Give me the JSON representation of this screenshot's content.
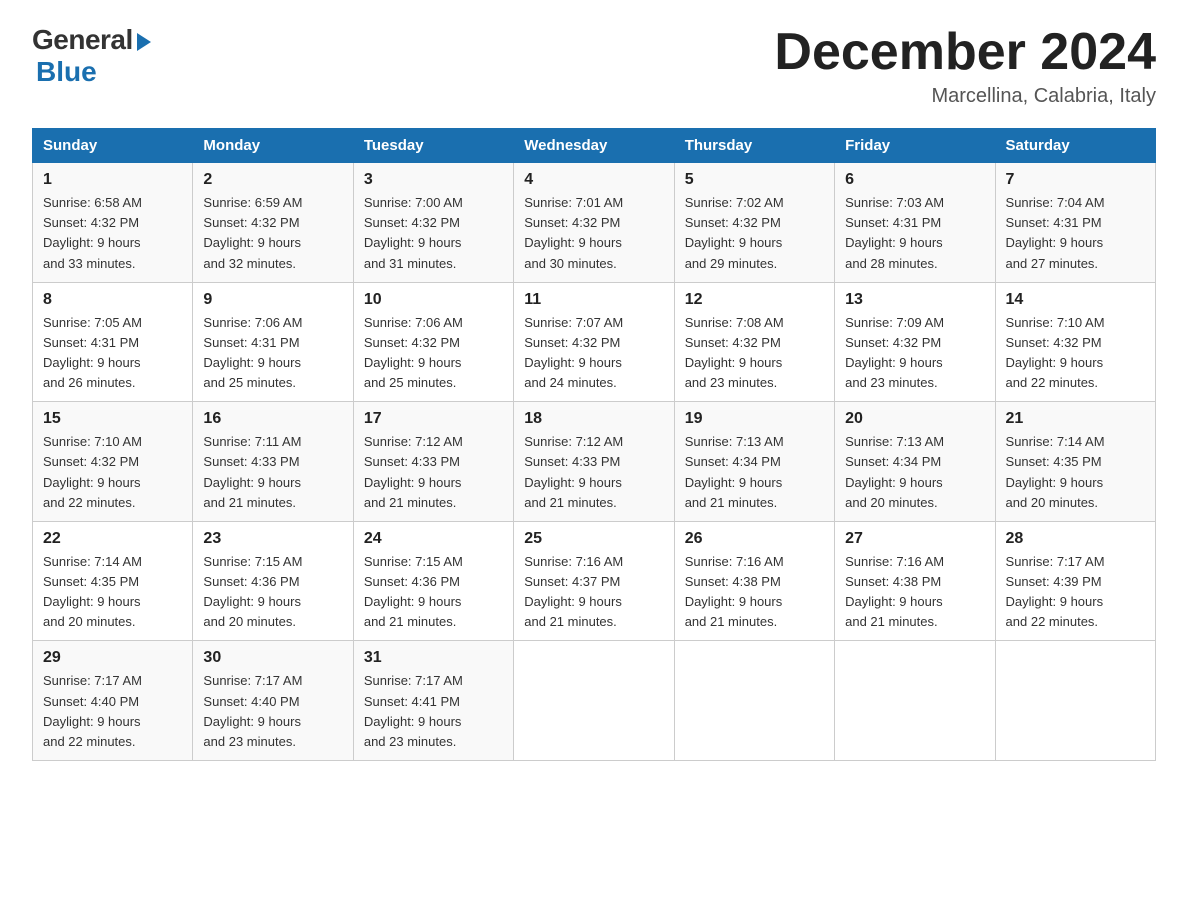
{
  "header": {
    "logo_general": "General",
    "logo_blue": "Blue",
    "title": "December 2024",
    "location": "Marcellina, Calabria, Italy"
  },
  "days_of_week": [
    "Sunday",
    "Monday",
    "Tuesday",
    "Wednesday",
    "Thursday",
    "Friday",
    "Saturday"
  ],
  "weeks": [
    [
      {
        "day": "1",
        "sunrise": "6:58 AM",
        "sunset": "4:32 PM",
        "daylight": "9 hours and 33 minutes."
      },
      {
        "day": "2",
        "sunrise": "6:59 AM",
        "sunset": "4:32 PM",
        "daylight": "9 hours and 32 minutes."
      },
      {
        "day": "3",
        "sunrise": "7:00 AM",
        "sunset": "4:32 PM",
        "daylight": "9 hours and 31 minutes."
      },
      {
        "day": "4",
        "sunrise": "7:01 AM",
        "sunset": "4:32 PM",
        "daylight": "9 hours and 30 minutes."
      },
      {
        "day": "5",
        "sunrise": "7:02 AM",
        "sunset": "4:32 PM",
        "daylight": "9 hours and 29 minutes."
      },
      {
        "day": "6",
        "sunrise": "7:03 AM",
        "sunset": "4:31 PM",
        "daylight": "9 hours and 28 minutes."
      },
      {
        "day": "7",
        "sunrise": "7:04 AM",
        "sunset": "4:31 PM",
        "daylight": "9 hours and 27 minutes."
      }
    ],
    [
      {
        "day": "8",
        "sunrise": "7:05 AM",
        "sunset": "4:31 PM",
        "daylight": "9 hours and 26 minutes."
      },
      {
        "day": "9",
        "sunrise": "7:06 AM",
        "sunset": "4:31 PM",
        "daylight": "9 hours and 25 minutes."
      },
      {
        "day": "10",
        "sunrise": "7:06 AM",
        "sunset": "4:32 PM",
        "daylight": "9 hours and 25 minutes."
      },
      {
        "day": "11",
        "sunrise": "7:07 AM",
        "sunset": "4:32 PM",
        "daylight": "9 hours and 24 minutes."
      },
      {
        "day": "12",
        "sunrise": "7:08 AM",
        "sunset": "4:32 PM",
        "daylight": "9 hours and 23 minutes."
      },
      {
        "day": "13",
        "sunrise": "7:09 AM",
        "sunset": "4:32 PM",
        "daylight": "9 hours and 23 minutes."
      },
      {
        "day": "14",
        "sunrise": "7:10 AM",
        "sunset": "4:32 PM",
        "daylight": "9 hours and 22 minutes."
      }
    ],
    [
      {
        "day": "15",
        "sunrise": "7:10 AM",
        "sunset": "4:32 PM",
        "daylight": "9 hours and 22 minutes."
      },
      {
        "day": "16",
        "sunrise": "7:11 AM",
        "sunset": "4:33 PM",
        "daylight": "9 hours and 21 minutes."
      },
      {
        "day": "17",
        "sunrise": "7:12 AM",
        "sunset": "4:33 PM",
        "daylight": "9 hours and 21 minutes."
      },
      {
        "day": "18",
        "sunrise": "7:12 AM",
        "sunset": "4:33 PM",
        "daylight": "9 hours and 21 minutes."
      },
      {
        "day": "19",
        "sunrise": "7:13 AM",
        "sunset": "4:34 PM",
        "daylight": "9 hours and 21 minutes."
      },
      {
        "day": "20",
        "sunrise": "7:13 AM",
        "sunset": "4:34 PM",
        "daylight": "9 hours and 20 minutes."
      },
      {
        "day": "21",
        "sunrise": "7:14 AM",
        "sunset": "4:35 PM",
        "daylight": "9 hours and 20 minutes."
      }
    ],
    [
      {
        "day": "22",
        "sunrise": "7:14 AM",
        "sunset": "4:35 PM",
        "daylight": "9 hours and 20 minutes."
      },
      {
        "day": "23",
        "sunrise": "7:15 AM",
        "sunset": "4:36 PM",
        "daylight": "9 hours and 20 minutes."
      },
      {
        "day": "24",
        "sunrise": "7:15 AM",
        "sunset": "4:36 PM",
        "daylight": "9 hours and 21 minutes."
      },
      {
        "day": "25",
        "sunrise": "7:16 AM",
        "sunset": "4:37 PM",
        "daylight": "9 hours and 21 minutes."
      },
      {
        "day": "26",
        "sunrise": "7:16 AM",
        "sunset": "4:38 PM",
        "daylight": "9 hours and 21 minutes."
      },
      {
        "day": "27",
        "sunrise": "7:16 AM",
        "sunset": "4:38 PM",
        "daylight": "9 hours and 21 minutes."
      },
      {
        "day": "28",
        "sunrise": "7:17 AM",
        "sunset": "4:39 PM",
        "daylight": "9 hours and 22 minutes."
      }
    ],
    [
      {
        "day": "29",
        "sunrise": "7:17 AM",
        "sunset": "4:40 PM",
        "daylight": "9 hours and 22 minutes."
      },
      {
        "day": "30",
        "sunrise": "7:17 AM",
        "sunset": "4:40 PM",
        "daylight": "9 hours and 23 minutes."
      },
      {
        "day": "31",
        "sunrise": "7:17 AM",
        "sunset": "4:41 PM",
        "daylight": "9 hours and 23 minutes."
      },
      null,
      null,
      null,
      null
    ]
  ]
}
